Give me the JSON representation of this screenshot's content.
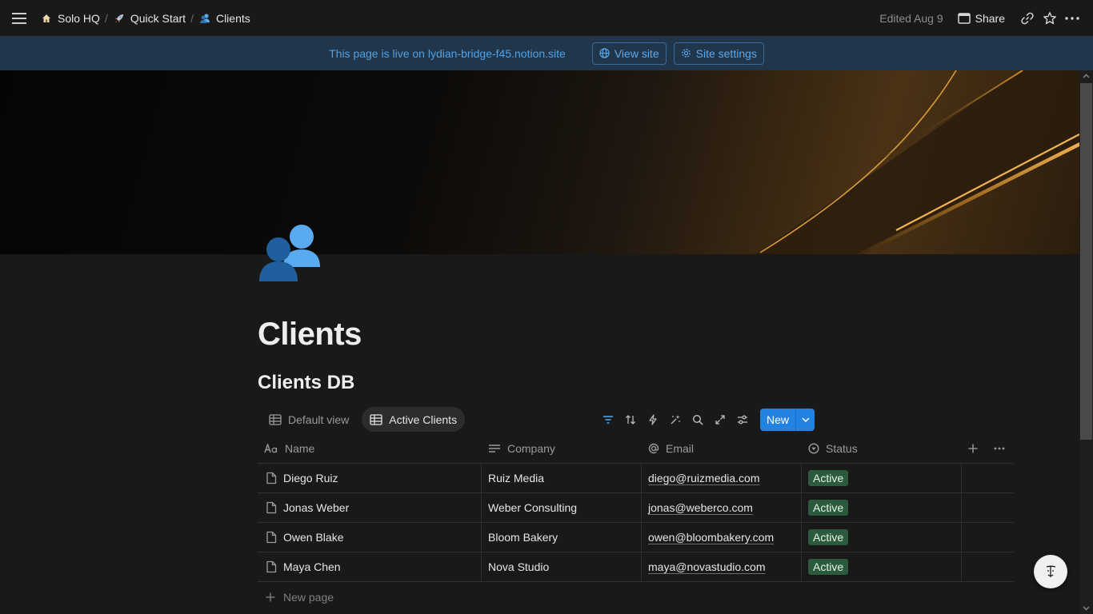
{
  "breadcrumb": {
    "items": [
      {
        "label": "Solo HQ",
        "icon": "house-icon"
      },
      {
        "label": "Quick Start",
        "icon": "rocket-icon"
      },
      {
        "label": "Clients",
        "icon": "people-icon"
      }
    ],
    "separator": "/"
  },
  "topbar": {
    "edited": "Edited Aug 9",
    "share_label": "Share"
  },
  "banner": {
    "text": "This page is live on lydian-bridge-f45.notion.site",
    "view_site": "View site",
    "site_settings": "Site settings"
  },
  "page": {
    "title": "Clients",
    "database_title": "Clients DB"
  },
  "views": [
    {
      "label": "Default view",
      "active": false
    },
    {
      "label": "Active Clients",
      "active": true
    }
  ],
  "toolbar": {
    "new_label": "New"
  },
  "table": {
    "columns": [
      {
        "label": "Name",
        "icon": "text-type-icon"
      },
      {
        "label": "Company",
        "icon": "lines-icon"
      },
      {
        "label": "Email",
        "icon": "at-icon"
      },
      {
        "label": "Status",
        "icon": "status-icon"
      }
    ],
    "rows": [
      {
        "name": "Diego Ruiz",
        "company": "Ruiz Media",
        "email": "diego@ruizmedia.com",
        "status": "Active"
      },
      {
        "name": "Jonas Weber",
        "company": "Weber Consulting",
        "email": "jonas@weberco.com",
        "status": "Active"
      },
      {
        "name": "Owen Blake",
        "company": "Bloom Bakery",
        "email": "owen@bloombakery.com",
        "status": "Active"
      },
      {
        "name": "Maya Chen",
        "company": "Nova Studio",
        "email": "maya@novastudio.com",
        "status": "Active"
      }
    ],
    "new_page_label": "New page"
  },
  "colors": {
    "accent": "#2383e2",
    "banner_bg": "#22364b",
    "banner_text": "#4ea2e6",
    "status_active": "#2b5a3c",
    "background": "#191919"
  }
}
